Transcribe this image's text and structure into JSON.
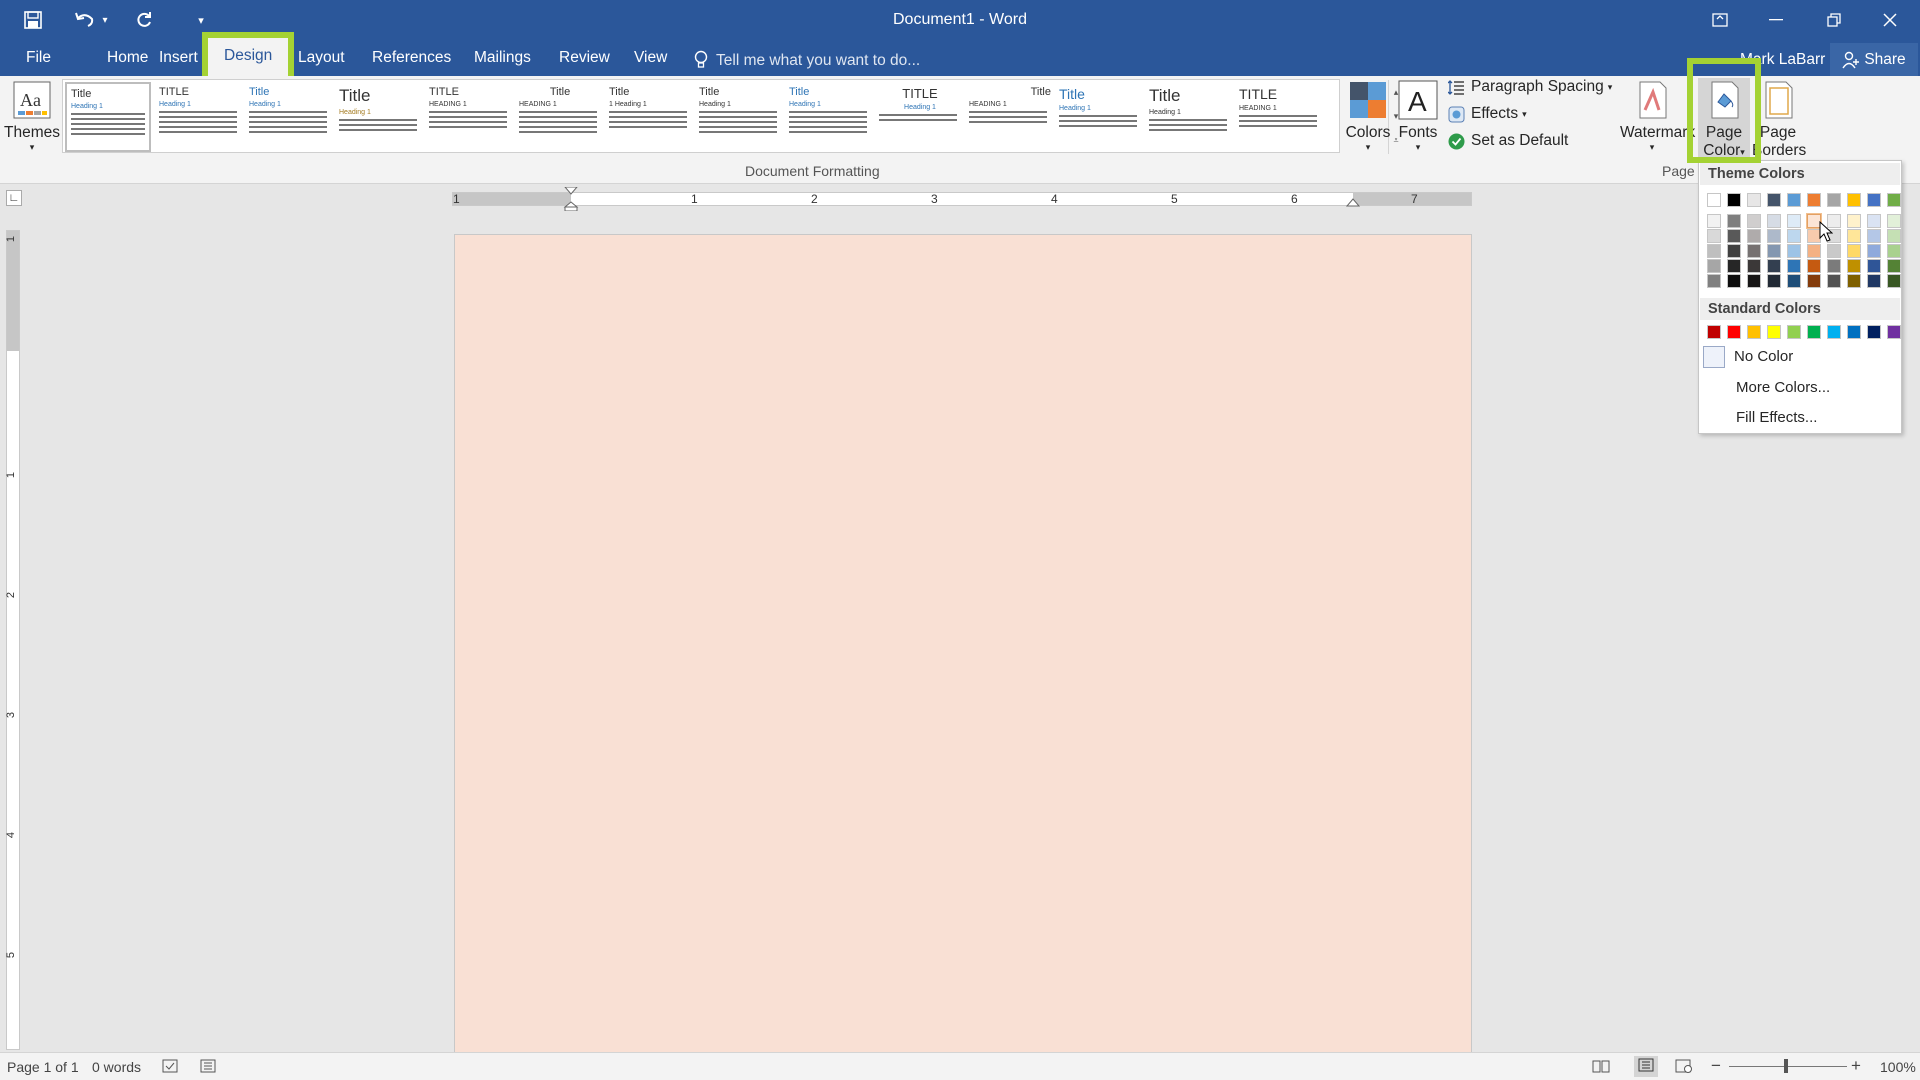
{
  "window": {
    "title": "Document1 - Word"
  },
  "qat": {
    "save_icon": "save-icon",
    "undo_icon": "undo-icon",
    "redo_icon": "redo-icon",
    "customize_icon": "customize-qat-icon"
  },
  "tabs": [
    {
      "label": "File"
    },
    {
      "label": "Home"
    },
    {
      "label": "Insert"
    },
    {
      "label": "Design"
    },
    {
      "label": "Layout"
    },
    {
      "label": "References"
    },
    {
      "label": "Mailings"
    },
    {
      "label": "Review"
    },
    {
      "label": "View"
    }
  ],
  "tellme": {
    "placeholder": "Tell me what you want to do..."
  },
  "user": {
    "name": "Mark LaBarr",
    "share": "Share"
  },
  "ribbon": {
    "themes": "Themes",
    "document_formatting": "Document Formatting",
    "style_set": [
      {
        "title": "Title",
        "heading": "Heading 1"
      },
      {
        "title": "TITLE",
        "heading": "Heading 1"
      },
      {
        "title": "Title",
        "heading": "Heading 1"
      },
      {
        "title": "Title",
        "heading": "Heading 1"
      },
      {
        "title": "TITLE",
        "heading": "HEADING 1"
      },
      {
        "title": "Title",
        "heading": "HEADING 1"
      },
      {
        "title": "Title",
        "heading": "1 Heading 1"
      },
      {
        "title": "Title",
        "heading": "Heading 1"
      },
      {
        "title": "Title",
        "heading": "Heading 1"
      },
      {
        "title": "TITLE",
        "heading": "Heading 1"
      },
      {
        "title": "Title",
        "heading": "HEADING 1"
      },
      {
        "title": "Title",
        "heading": "Heading 1"
      },
      {
        "title": "Title",
        "heading": "Heading 1"
      },
      {
        "title": "TITLE",
        "heading": "HEADING 1"
      }
    ],
    "colors": "Colors",
    "fonts": "Fonts",
    "paragraph_spacing": "Paragraph Spacing",
    "effects": "Effects",
    "set_as_default": "Set as Default",
    "watermark": "Watermark",
    "page_color_1": "Page",
    "page_color_2": "Color",
    "page_borders_1": "Page",
    "page_borders_2": "Borders",
    "page_bg_group": "Page"
  },
  "ruler": {
    "h_numbers": [
      "1",
      "1",
      "2",
      "3",
      "4",
      "5",
      "6",
      "7"
    ],
    "v_numbers": [
      "1",
      "1",
      "2",
      "3",
      "4",
      "5"
    ]
  },
  "page": {
    "background_color": "#f9e0d4"
  },
  "status": {
    "page": "Page 1 of 1",
    "words": "0 words",
    "zoom": "100%"
  },
  "page_color_menu": {
    "theme_header": "Theme Colors",
    "standard_header": "Standard Colors",
    "no_color": "No Color",
    "more_colors": "More Colors...",
    "fill_effects": "Fill Effects...",
    "theme_columns": [
      [
        "#ffffff",
        "#f2f2f2",
        "#d9d9d9",
        "#bfbfbf",
        "#a6a6a6",
        "#808080"
      ],
      [
        "#000000",
        "#7f7f7f",
        "#595959",
        "#404040",
        "#262626",
        "#0d0d0d"
      ],
      [
        "#e7e6e6",
        "#d0cece",
        "#afabab",
        "#767171",
        "#3b3838",
        "#171616"
      ],
      [
        "#44546a",
        "#d6dce5",
        "#adb9ca",
        "#8497b0",
        "#333f50",
        "#222a35"
      ],
      [
        "#5b9bd5",
        "#deebf7",
        "#bdd7ee",
        "#9dc3e6",
        "#2e75b6",
        "#1f4e79"
      ],
      [
        "#ed7d31",
        "#fbe5d6",
        "#f8cbad",
        "#f4b183",
        "#c55a11",
        "#843c0c"
      ],
      [
        "#a5a5a5",
        "#ededed",
        "#dbdbdb",
        "#c9c9c9",
        "#7b7b7b",
        "#525252"
      ],
      [
        "#ffc000",
        "#fff2cc",
        "#ffe699",
        "#ffd966",
        "#bf9000",
        "#7f6000"
      ],
      [
        "#4472c4",
        "#dae3f3",
        "#b4c7e7",
        "#8faadc",
        "#2f5597",
        "#203864"
      ],
      [
        "#70ad47",
        "#e2f0d9",
        "#c5e0b4",
        "#a9d18e",
        "#548235",
        "#385723"
      ]
    ],
    "standard_colors": [
      "#c00000",
      "#ff0000",
      "#ffc000",
      "#ffff00",
      "#92d050",
      "#00b050",
      "#00b0f0",
      "#0070c0",
      "#002060",
      "#7030a0"
    ]
  }
}
